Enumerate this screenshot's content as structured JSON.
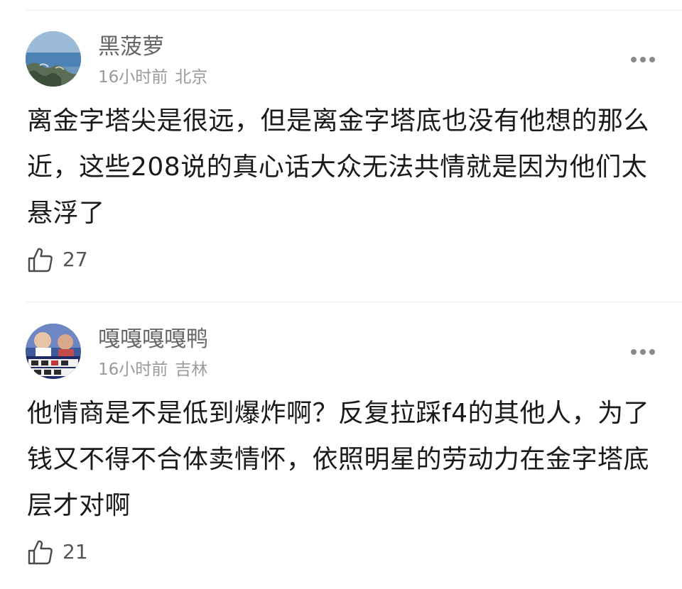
{
  "comments": [
    {
      "username": "黑菠萝",
      "time": "16小时前",
      "location": "北京",
      "text": "离金字塔尖是很远，但是离金字塔底也没有他想的那么近，这些208说的真心话大众无法共情就是因为他们太悬浮了",
      "likes": "27",
      "avatar": "seaside-rocks-avatar",
      "more_icon": "more-dots-icon",
      "like_icon": "thumbs-up-icon"
    },
    {
      "username": "嘎嘎嘎嘎鸭",
      "time": "16小时前",
      "location": "吉林",
      "text": "他情商是不是低到爆炸啊？反复拉踩f4的其他人，为了钱又不得不合体卖情怀，依照明星的劳动力在金字塔底层才对啊",
      "likes": "21",
      "avatar": "tv-show-screenshot-avatar",
      "more_icon": "more-dots-icon",
      "like_icon": "thumbs-up-icon"
    }
  ]
}
